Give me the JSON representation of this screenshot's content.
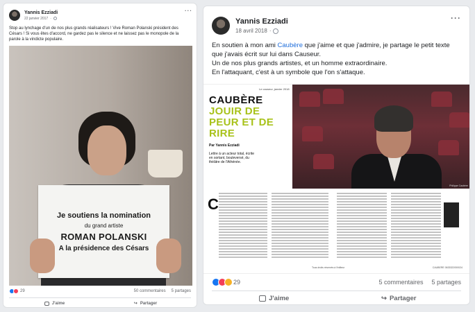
{
  "left_post": {
    "author": "Yannis Ezziadi",
    "date": "22 janvier 2017",
    "text": "Stop au lynchage d'un de nos plus grands réalisateurs ! Vive Roman Polanski président des Césars ! Si vous êtes d'accord, ne gardez pas le silence et ne laissez pas le monopole de la parole à la vindicte populaire.",
    "sign": {
      "line1": "Je soutiens la nomination",
      "line2": "du grand artiste",
      "line3": "ROMAN POLANSKI",
      "line4": "A la présidence des Césars"
    },
    "reaction_count": "29",
    "comments": "50 commentaires",
    "shares": "5 partages",
    "like_label": "J'aime",
    "share_label": "Partager"
  },
  "right_post": {
    "author": "Yannis Ezziadi",
    "date": "18 avril 2018",
    "text_before_link": "En soutien à mon ami ",
    "link": "Caubère",
    "text_after_link": " que j'aime et que j'admire, je partage le petit texte que j'avais écrit sur lui dans Causeur.",
    "line2": "Un de nos plus grands artistes, et un homme extraordinaire.",
    "line3": "En l'attaquant, c'est à un symbole que l'on s'attaque.",
    "magazine": {
      "issue": "Le causeur, janvier 2018",
      "title1": "CAUBÈRE",
      "title2": "JOUIR DE PEUR ET DE RIRE",
      "byline": "Par Yannis Ezziadi",
      "intro": "Lettre à un acteur total, écrite en sortant, bouleversé, du théâtre de l'Athénée.",
      "dropcap": "C",
      "photo_credit": "Philippe Caubère",
      "footer_left": "Tous droits réservés à l'éditeur",
      "footer_right": "CAUBERE 0633322000024"
    },
    "reaction_count": "29",
    "comments": "5 commentaires",
    "shares": "5 partages",
    "like_label": "J'aime",
    "share_label": "Partager"
  },
  "colors": {
    "facebook_blue": "#1877f2",
    "link_blue": "#216fdb",
    "title_green": "#a8c21a"
  }
}
